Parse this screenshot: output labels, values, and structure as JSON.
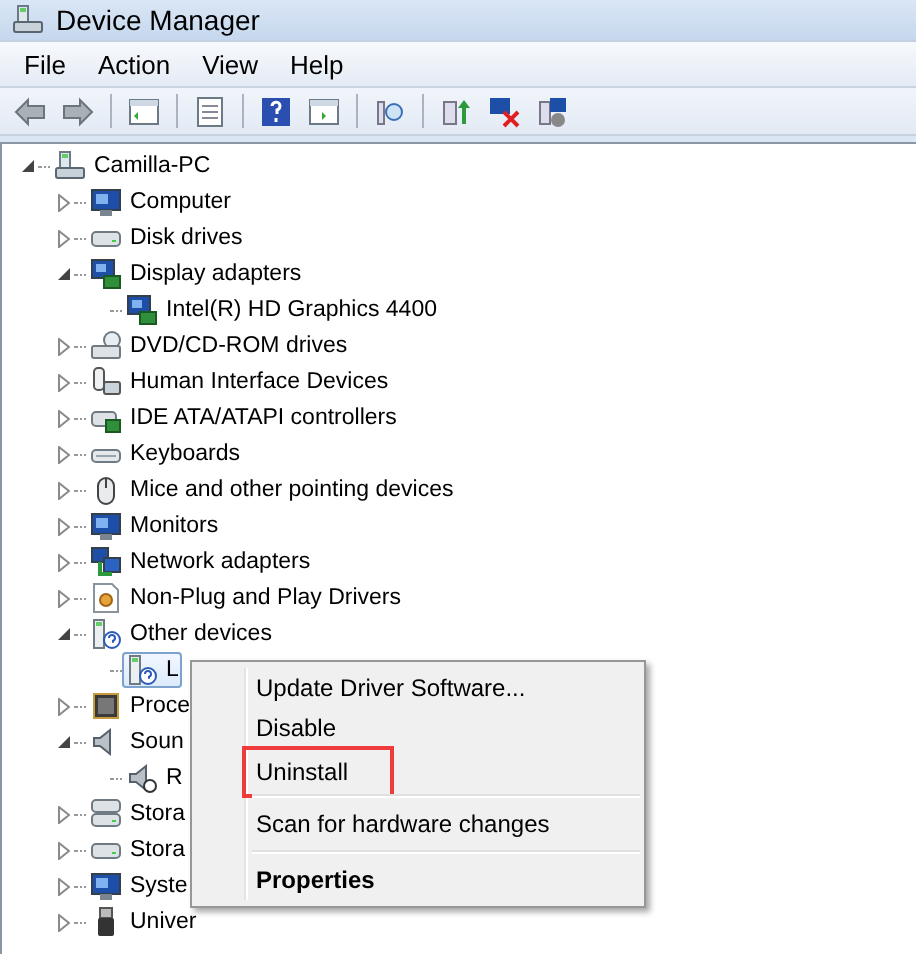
{
  "window": {
    "title": "Device Manager"
  },
  "menu_bar": [
    "File",
    "Action",
    "View",
    "Help"
  ],
  "tree": {
    "label": "Camilla-PC",
    "expanded": true,
    "selected": false,
    "children": [
      {
        "label": "Computer",
        "expanded": false,
        "selected": false
      },
      {
        "label": "Disk drives",
        "expanded": false,
        "selected": false
      },
      {
        "label": "Display adapters",
        "expanded": true,
        "selected": false,
        "children": [
          {
            "label": "Intel(R) HD Graphics 4400",
            "selected": false
          }
        ]
      },
      {
        "label": "DVD/CD-ROM drives",
        "expanded": false,
        "selected": false
      },
      {
        "label": "Human Interface Devices",
        "expanded": false,
        "selected": false
      },
      {
        "label": "IDE ATA/ATAPI controllers",
        "expanded": false,
        "selected": false
      },
      {
        "label": "Keyboards",
        "expanded": false,
        "selected": false
      },
      {
        "label": "Mice and other pointing devices",
        "expanded": false,
        "selected": false
      },
      {
        "label": "Monitors",
        "expanded": false,
        "selected": false
      },
      {
        "label": "Network adapters",
        "expanded": false,
        "selected": false
      },
      {
        "label": "Non-Plug and Play Drivers",
        "expanded": false,
        "selected": false
      },
      {
        "label": "Other devices",
        "expanded": true,
        "selected": false,
        "children": [
          {
            "label": "L",
            "selected": true
          }
        ]
      },
      {
        "label": "Proce",
        "expanded": false,
        "selected": false
      },
      {
        "label": "Soun",
        "expanded": true,
        "selected": false,
        "children": [
          {
            "label": "R",
            "selected": false
          }
        ]
      },
      {
        "label": "Stora",
        "expanded": false,
        "selected": false
      },
      {
        "label": "Stora",
        "expanded": false,
        "selected": false
      },
      {
        "label": "Syste",
        "expanded": false,
        "selected": false
      },
      {
        "label": "Univer",
        "expanded": false,
        "selected": false
      }
    ]
  },
  "context_menu": [
    {
      "kind": "command",
      "label": "Update Driver Software...",
      "highlighted": false
    },
    {
      "kind": "command",
      "label": "Disable",
      "highlighted": false
    },
    {
      "kind": "command",
      "label": "Uninstall",
      "highlighted": true
    },
    {
      "kind": "separator"
    },
    {
      "kind": "command",
      "label": "Scan for hardware changes",
      "highlighted": false
    },
    {
      "kind": "separator"
    },
    {
      "kind": "default",
      "label": "Properties",
      "highlighted": false
    }
  ]
}
